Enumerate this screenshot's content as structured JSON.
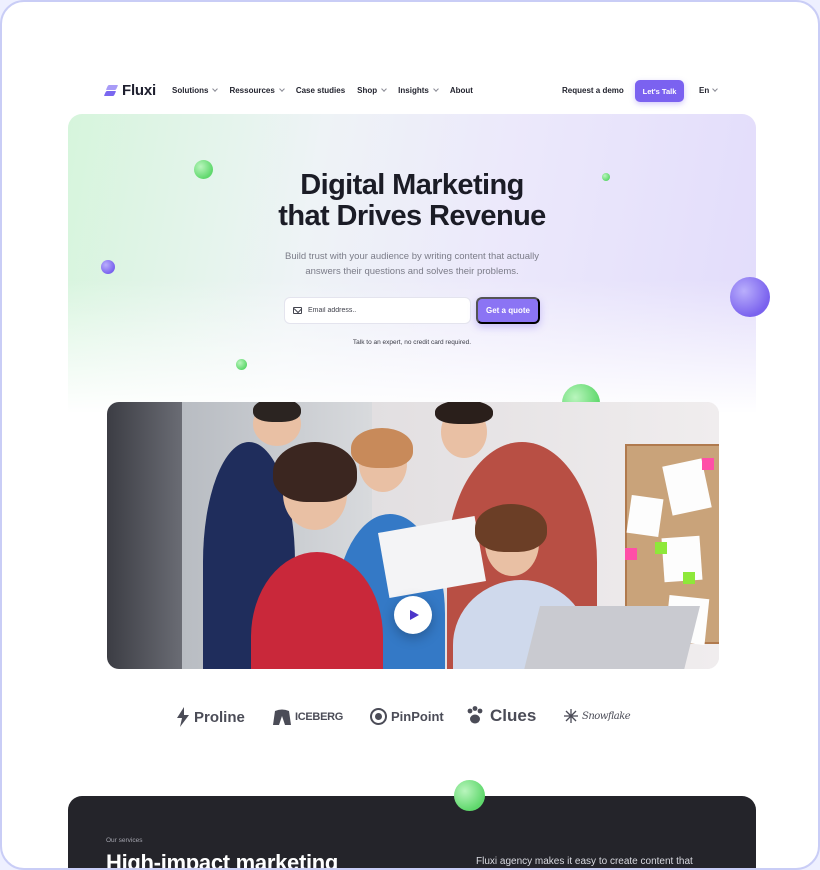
{
  "nav": {
    "logo_text": "Fluxi",
    "menu": [
      {
        "label": "Solutions",
        "has_dropdown": true
      },
      {
        "label": "Ressources",
        "has_dropdown": true
      },
      {
        "label": "Case studies",
        "has_dropdown": false
      },
      {
        "label": "Shop",
        "has_dropdown": true
      },
      {
        "label": "Insights",
        "has_dropdown": true
      },
      {
        "label": "About",
        "has_dropdown": false
      }
    ],
    "request_demo": "Request a demo",
    "cta": "Let's Talk",
    "language": "En"
  },
  "hero": {
    "title_line1": "Digital Marketing",
    "title_line2": "that Drives Revenue",
    "subtitle_line1": "Build trust with your audience by writing content that actually",
    "subtitle_line2": "answers their questions and solves their problems.",
    "email_placeholder": "Email address..",
    "submit_label": "Get a quote",
    "note": "Talk to an expert, no credit card required."
  },
  "video": {
    "play_icon": "play-icon"
  },
  "logos": [
    {
      "name": "Proline",
      "icon": "bolt-icon"
    },
    {
      "name": "ICEBERG",
      "icon": "iceberg-icon"
    },
    {
      "name": "PinPoint",
      "icon": "pinpoint-icon"
    },
    {
      "name": "Clues",
      "icon": "paw-icon"
    },
    {
      "name": "Snowflake",
      "icon": "snowflake-icon"
    }
  ],
  "services": {
    "tag": "Our services",
    "title": "High-impact marketing",
    "description": "Fluxi agency makes it easy to create content that"
  },
  "colors": {
    "accent": "#7b62f0",
    "dark_section": "#24242a",
    "green_ball": "#5fd86c",
    "purple_ball": "#7a62ee"
  }
}
